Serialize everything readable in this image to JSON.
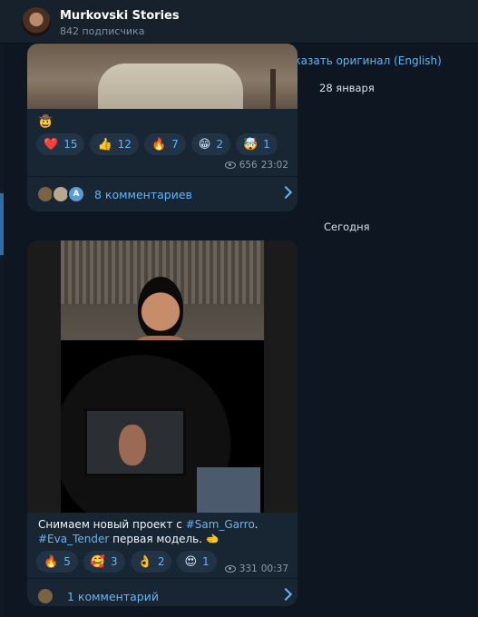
{
  "header": {
    "title": "Murkovski Stories",
    "subtitle": "842 подписчика"
  },
  "translate": {
    "label": "Показать оригинал (English)"
  },
  "dates": {
    "d1": "28 января",
    "d2": "Сегодня"
  },
  "post1": {
    "emoji": "🤠",
    "reactions": [
      {
        "emoji": "❤️",
        "count": "15"
      },
      {
        "emoji": "👍",
        "count": "12"
      },
      {
        "emoji": "🔥",
        "count": "7"
      },
      {
        "emoji": "😁",
        "count": "2"
      },
      {
        "emoji": "🤯",
        "count": "1"
      }
    ],
    "views": "656",
    "time": "23:02",
    "comments_label": "8 комментариев",
    "comment_avatar_letter": "A"
  },
  "post2": {
    "caption_line1": "Снимаем новый проект с ",
    "tag1": "#Sam_Garro",
    "caption_after_tag1": ".",
    "tag2": "#Eva_Tender",
    "caption_line2_rest": " первая модель. ",
    "caption_emoji": "🫲",
    "reactions": [
      {
        "emoji": "🔥",
        "count": "5"
      },
      {
        "emoji": "🥰",
        "count": "3"
      },
      {
        "emoji": "👌",
        "count": "2"
      },
      {
        "emoji": "😍",
        "count": "1"
      }
    ],
    "views": "331",
    "time": "00:37",
    "comments_label": "1 комментарий"
  }
}
